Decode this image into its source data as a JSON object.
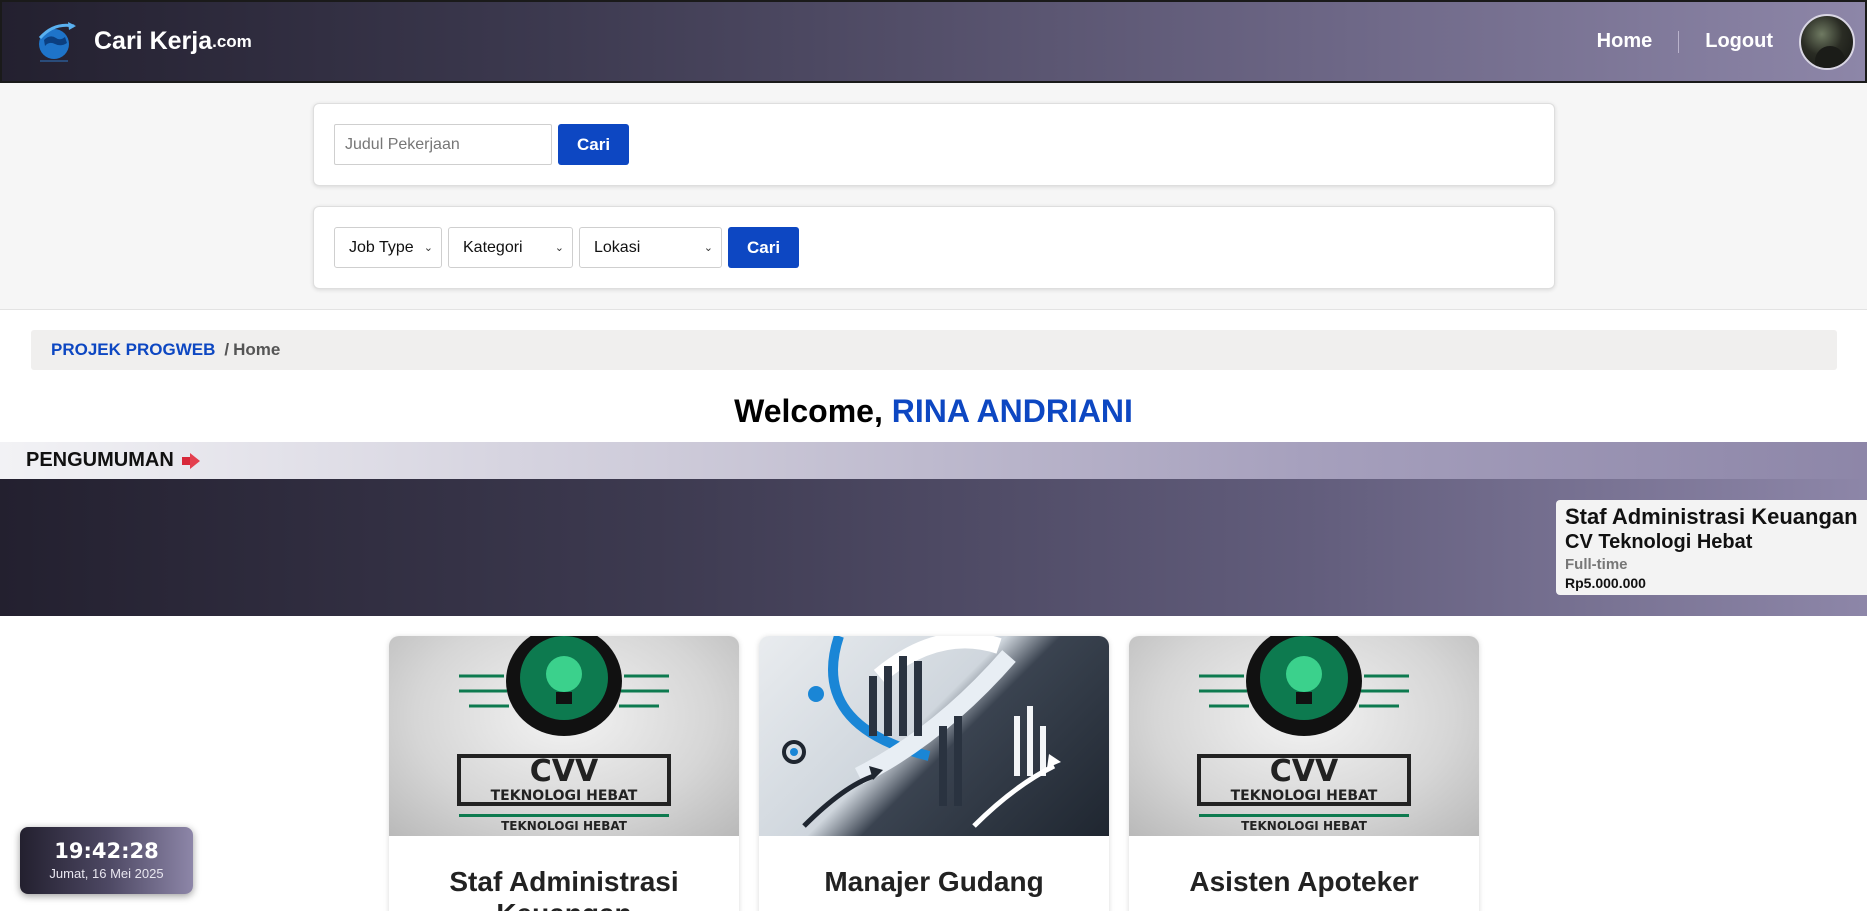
{
  "navbar": {
    "brand_name": "Cari Kerja",
    "brand_suffix": ".com",
    "links": [
      {
        "label": "Home"
      },
      {
        "label": "Logout"
      }
    ]
  },
  "search": {
    "placeholder": "Judul Pekerjaan",
    "button_label": "Cari"
  },
  "filters": {
    "job_type": "Job Type",
    "kategori": "Kategori",
    "lokasi": "Lokasi",
    "button_label": "Cari"
  },
  "breadcrumb": {
    "root": "PROJEK PROGWEB",
    "separator": "/",
    "current": "Home"
  },
  "welcome": {
    "prefix": "Welcome, ",
    "name": "RINA ANDRIANI"
  },
  "announcement": {
    "heading": "PENGUMUMAN",
    "icon": "megaphone-icon",
    "item": {
      "title": "Staf Administrasi Keuangan",
      "company": "CV Teknologi Hebat",
      "type": "Full-time",
      "salary": "Rp5.000.000"
    }
  },
  "jobs": [
    {
      "title": "Staf Administrasi Keuangan",
      "image": "cv-teknologi-hebat-logo"
    },
    {
      "title": "Manajer Gudang",
      "image": "warehouse-chart-graphic"
    },
    {
      "title": "Asisten Apoteker",
      "image": "cv-teknologi-hebat-logo"
    }
  ],
  "clock": {
    "time": "19:42:28",
    "date": "Jumat, 16 Mei 2025"
  },
  "colors": {
    "accent": "#0d47c2",
    "nav_dark": "#23202f",
    "nav_light": "#8d86a8"
  }
}
